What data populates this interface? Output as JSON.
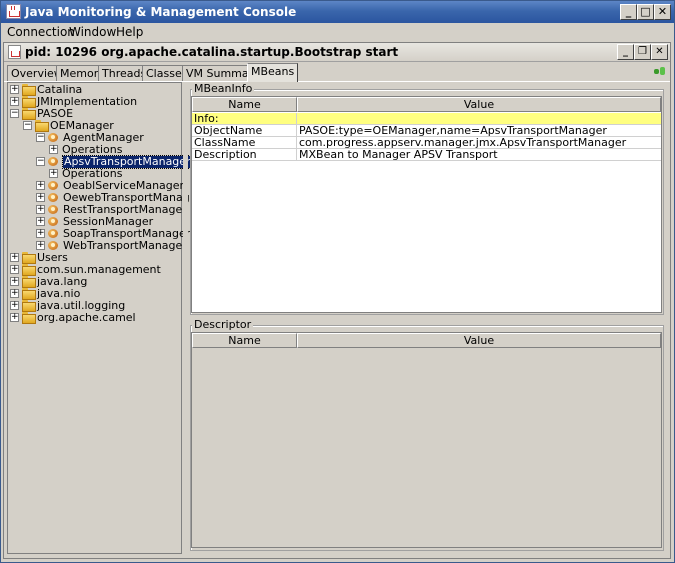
{
  "window": {
    "title": "Java Monitoring & Management Console",
    "minimize": "_",
    "maximize": "□",
    "close": "✕"
  },
  "menu": [
    "Connection",
    "Window",
    "Help"
  ],
  "inner": {
    "title": "pid: 10296 org.apache.catalina.startup.Bootstrap start",
    "minimize": "_",
    "restore": "❐",
    "close": "✕"
  },
  "tabs": [
    "Overview",
    "Memory",
    "Threads",
    "Classes",
    "VM Summary",
    "MBeans"
  ],
  "active_tab": "MBeans",
  "tree": [
    {
      "label": "Catalina",
      "icon": "folder-icon",
      "expander": "+"
    },
    {
      "label": "JMImplementation",
      "icon": "folder-icon",
      "expander": "+"
    },
    {
      "label": "PASOE",
      "icon": "folder-icon",
      "expander": "−"
    },
    {
      "label": "OEManager",
      "icon": "folder-icon",
      "expander": "−"
    },
    {
      "label": "AgentManager",
      "icon": "bean-icon",
      "expander": "−"
    },
    {
      "label": "Operations",
      "icon": "",
      "expander": "+"
    },
    {
      "label": "ApsvTransportManager",
      "icon": "bean-icon",
      "expander": "−",
      "selected": true
    },
    {
      "label": "Operations",
      "icon": "",
      "expander": "+"
    },
    {
      "label": "OeablServiceManager",
      "icon": "bean-icon",
      "expander": "+"
    },
    {
      "label": "OewebTransportManager",
      "icon": "bean-icon",
      "expander": "+"
    },
    {
      "label": "RestTransportManager",
      "icon": "bean-icon",
      "expander": "+"
    },
    {
      "label": "SessionManager",
      "icon": "bean-icon",
      "expander": "+"
    },
    {
      "label": "SoapTransportManager",
      "icon": "bean-icon",
      "expander": "+"
    },
    {
      "label": "WebTransportManager",
      "icon": "bean-icon",
      "expander": "+"
    },
    {
      "label": "Users",
      "icon": "folder-icon",
      "expander": "+"
    },
    {
      "label": "com.sun.management",
      "icon": "folder-icon",
      "expander": "+"
    },
    {
      "label": "java.lang",
      "icon": "folder-icon",
      "expander": "+"
    },
    {
      "label": "java.nio",
      "icon": "folder-icon",
      "expander": "+"
    },
    {
      "label": "java.util.logging",
      "icon": "folder-icon",
      "expander": "+"
    },
    {
      "label": "org.apache.camel",
      "icon": "folder-icon",
      "expander": "+"
    }
  ],
  "mbeaninfo": {
    "group_label": "MBeanInfo",
    "columns": [
      "Name",
      "Value"
    ],
    "rows": [
      {
        "name": "Info:",
        "value": "",
        "highlight": true
      },
      {
        "name": "ObjectName",
        "value": "PASOE:type=OEManager,name=ApsvTransportManager"
      },
      {
        "name": "ClassName",
        "value": "com.progress.appserv.manager.jmx.ApsvTransportManager"
      },
      {
        "name": "Description",
        "value": "MXBean to Manager APSV Transport"
      }
    ]
  },
  "descriptor": {
    "group_label": "Descriptor",
    "columns": [
      "Name",
      "Value"
    ]
  },
  "colors": {
    "titlebar": "#3a66ac",
    "selection": "#0a246a",
    "info_row": "#ffff80"
  }
}
